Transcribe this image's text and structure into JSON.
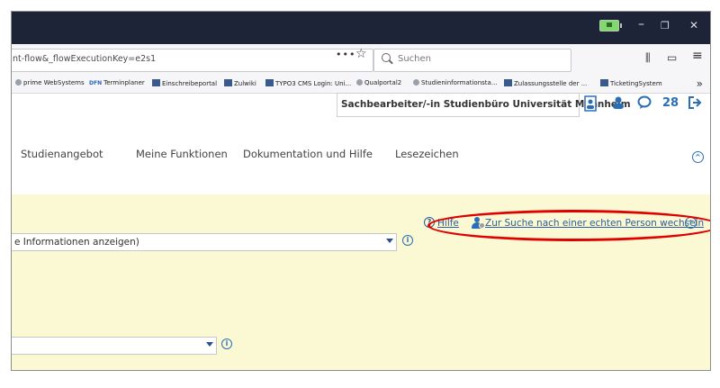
{
  "window": {
    "minimize_glyph": "–",
    "maximize_glyph": "❐",
    "close_glyph": "✕"
  },
  "navbar": {
    "url": "nt-flow&_flowExecutionKey=e2s1",
    "page_actions": "•••",
    "star_glyph": "☆",
    "search_placeholder": "Suchen",
    "library_glyph": "⫼",
    "sidebar_glyph": "▭",
    "menu_glyph": "≡"
  },
  "bookmarks": [
    {
      "label": "prime WebSystems",
      "icon": "globe"
    },
    {
      "label": "Terminplaner",
      "icon": "dfn"
    },
    {
      "label": "Einschreibeportal",
      "icon": "uma"
    },
    {
      "label": "Zulwiki",
      "icon": "uma"
    },
    {
      "label": "TYPO3 CMS Login: Uni...",
      "icon": "uma"
    },
    {
      "label": "Qualportal2",
      "icon": "globe"
    },
    {
      "label": "Studieninformationsta...",
      "icon": "globe"
    },
    {
      "label": "Zulassungsstelle der ...",
      "icon": "uma"
    },
    {
      "label": "TicketingSystem",
      "icon": "uma"
    }
  ],
  "bookmarks_more": "»",
  "header": {
    "role_select": "Sachbearbeiter/-in Studienbüro Universität Mannheim",
    "messages_count": "28"
  },
  "menu": {
    "items": [
      "Studienangebot",
      "Meine Funktionen",
      "Dokumentation und Hilfe",
      "Lesezeichen"
    ]
  },
  "content": {
    "help_link": "Hilfe",
    "switch_person_link": "Zur Suche nach einer echten Person wechseln",
    "select1_value": "e Informationen anzeigen)",
    "info_glyph": "i",
    "collapse_glyph": "^",
    "help_glyph": "?"
  },
  "colors": {
    "titlebar": "#1e2438",
    "content_bg": "#fbf8d4",
    "link": "#2a5c9a",
    "accent": "#2a6fb5",
    "annotation": "#e00000"
  }
}
